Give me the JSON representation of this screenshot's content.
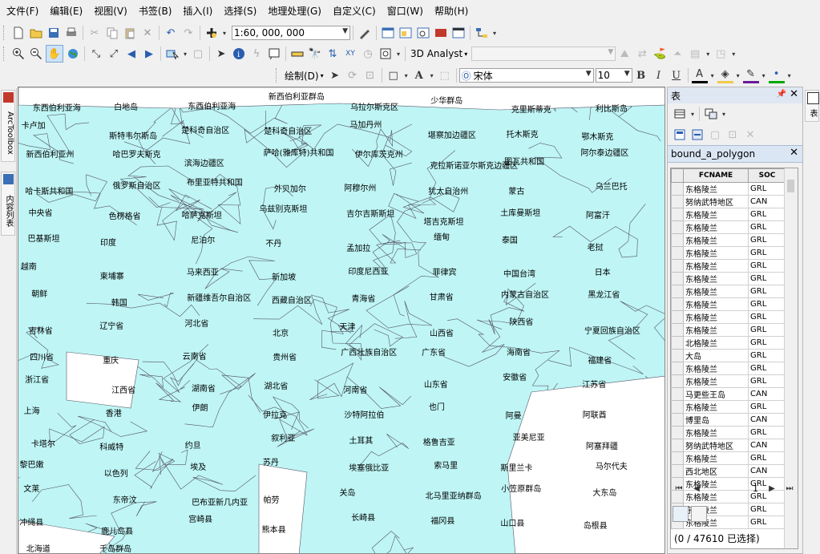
{
  "menu": [
    "文件(F)",
    "编辑(E)",
    "视图(V)",
    "书签(B)",
    "插入(I)",
    "选择(S)",
    "地理处理(G)",
    "自定义(C)",
    "窗口(W)",
    "帮助(H)"
  ],
  "toolbar": {
    "scale": "1:60, 000, 000",
    "analyst_label": "3D Analyst",
    "draw_label": "绘制(D)",
    "font_name": "宋体",
    "font_size": "10",
    "bold": "B",
    "italic": "I",
    "underline": "U",
    "font_color_glyph": "A"
  },
  "left_tabs": [
    "ArcToolbox",
    "内容列表"
  ],
  "right_tabs": [
    "表"
  ],
  "map": {
    "background_color": "#bff5f5",
    "labels": [
      "东西伯利亚海",
      "白地岛",
      "东西伯利亚海",
      "新西伯利亚群岛",
      "乌拉尔斯克区",
      "少华群岛",
      "克里斯蒂克",
      "利比斯岛",
      "卡卢加",
      "斯特韦尔斯岛",
      "楚科奇自治区",
      "楚科奇自治区",
      "马加丹州",
      "堪察加边疆区",
      "托木斯克",
      "鄂木斯克",
      "新西伯利亚州",
      "哈巴罗夫斯克",
      "滨海边疆区",
      "萨哈(雅库特)共和国",
      "伊尔库茨克州",
      "克拉斯诺亚尔斯克边疆区",
      "图瓦共和国",
      "阿尔泰边疆区",
      "哈卡斯共和国",
      "俄罗斯自治区",
      "布里亚特共和国",
      "外贝加尔",
      "阿穆尔州",
      "犹太自治州",
      "蒙古",
      "乌兰巴托",
      "中央省",
      "色楞格省",
      "哈萨克斯坦",
      "乌兹别克斯坦",
      "吉尔吉斯斯坦",
      "塔吉克斯坦",
      "土库曼斯坦",
      "阿富汗",
      "巴基斯坦",
      "印度",
      "尼泊尔",
      "不丹",
      "孟加拉",
      "缅甸",
      "泰国",
      "老挝",
      "越南",
      "柬埔寨",
      "马来西亚",
      "新加坡",
      "印度尼西亚",
      "菲律宾",
      "中国台湾",
      "日本",
      "朝鲜",
      "韩国",
      "新疆维吾尔自治区",
      "西藏自治区",
      "青海省",
      "甘肃省",
      "内蒙古自治区",
      "黑龙江省",
      "吉林省",
      "辽宁省",
      "河北省",
      "北京",
      "天津",
      "山西省",
      "陕西省",
      "宁夏回族自治区",
      "四川省",
      "重庆",
      "云南省",
      "贵州省",
      "广西壮族自治区",
      "广东省",
      "海南省",
      "福建省",
      "浙江省",
      "江西省",
      "湖南省",
      "湖北省",
      "河南省",
      "山东省",
      "安徽省",
      "江苏省",
      "上海",
      "香港",
      "伊朗",
      "伊拉克",
      "沙特阿拉伯",
      "也门",
      "阿曼",
      "阿联酋",
      "卡塔尔",
      "科威特",
      "约旦",
      "叙利亚",
      "土耳其",
      "格鲁吉亚",
      "亚美尼亚",
      "阿塞拜疆",
      "黎巴嫩",
      "以色列",
      "埃及",
      "苏丹",
      "埃塞俄比亚",
      "索马里",
      "斯里兰卡",
      "马尔代夫",
      "文莱",
      "东帝汶",
      "巴布亚新几内亚",
      "帕劳",
      "关岛",
      "北马里亚纳群岛",
      "小笠原群岛",
      "大东岛",
      "冲绳县",
      "鹿儿岛县",
      "宫崎县",
      "熊本县",
      "长崎县",
      "福冈县",
      "山口县",
      "岛根县",
      "北海道",
      "千岛群岛"
    ]
  },
  "panel": {
    "title": "表",
    "layer_name": "bound_a_polygon",
    "columns": [
      "FCNAME",
      "SOC"
    ],
    "rows": [
      [
        "东格陵兰",
        "GRL"
      ],
      [
        "努纳武特地区",
        "CAN"
      ],
      [
        "东格陵兰",
        "GRL"
      ],
      [
        "东格陵兰",
        "GRL"
      ],
      [
        "东格陵兰",
        "GRL"
      ],
      [
        "东格陵兰",
        "GRL"
      ],
      [
        "东格陵兰",
        "GRL"
      ],
      [
        "东格陵兰",
        "GRL"
      ],
      [
        "东格陵兰",
        "GRL"
      ],
      [
        "东格陵兰",
        "GRL"
      ],
      [
        "东格陵兰",
        "GRL"
      ],
      [
        "东格陵兰",
        "GRL"
      ],
      [
        "北格陵兰",
        "GRL"
      ],
      [
        "大岛",
        "GRL"
      ],
      [
        "东格陵兰",
        "GRL"
      ],
      [
        "东格陵兰",
        "GRL"
      ],
      [
        "马更些王岛",
        "CAN"
      ],
      [
        "东格陵兰",
        "GRL"
      ],
      [
        "博里岛",
        "CAN"
      ],
      [
        "东格陵兰",
        "GRL"
      ],
      [
        "努纳武特地区",
        "CAN"
      ],
      [
        "东格陵兰",
        "GRL"
      ],
      [
        "西北地区",
        "CAN"
      ],
      [
        "东格陵兰",
        "GRL"
      ],
      [
        "东格陵兰",
        "GRL"
      ],
      [
        "东格陵兰",
        "GRL"
      ],
      [
        "东格陵兰",
        "GRL"
      ]
    ],
    "page": "1",
    "status": "(0 / 47610 已选择)"
  }
}
